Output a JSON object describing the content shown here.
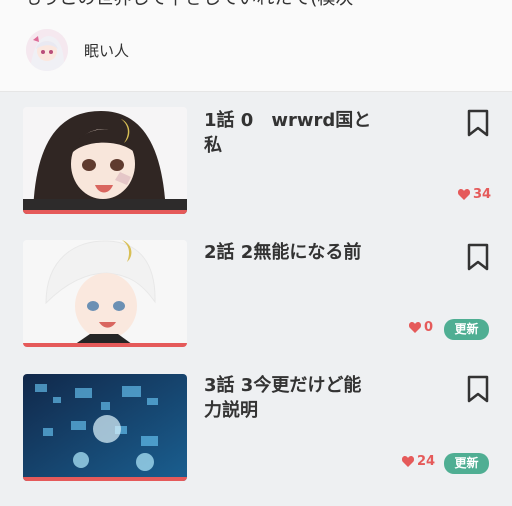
{
  "header": {
    "title_cutoff": "もうこの世界して下さしていれたて(模次",
    "author": "眠い人"
  },
  "episodes": [
    {
      "title": "1話 0　wrwrd国と私",
      "likes": "34",
      "badge": ""
    },
    {
      "title": "2話 2無能になる前",
      "likes": "0",
      "badge": "更新"
    },
    {
      "title": "3話 3今更だけど能力説明",
      "likes": "24",
      "badge": "更新"
    }
  ],
  "colors": {
    "accent": "#e55a5a",
    "badge": "#4fae93"
  },
  "icons": {
    "bookmark": "bookmark-icon",
    "heart": "heart-icon"
  }
}
